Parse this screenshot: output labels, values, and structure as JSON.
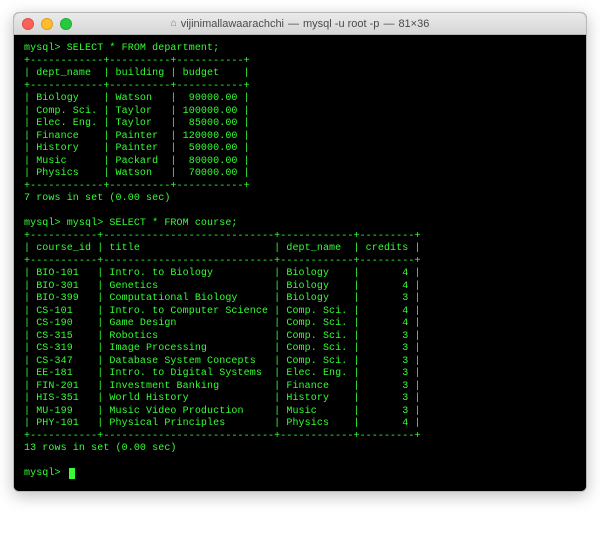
{
  "window": {
    "title_user": "vijinimallawaarachchi",
    "title_cmd": "mysql -u root -p",
    "title_dims": "81×36"
  },
  "prompt": "mysql>",
  "query1": {
    "sql": "SELECT * FROM department;",
    "headers": {
      "c1": "dept_name",
      "c2": "building",
      "c3": "budget"
    },
    "rows": [
      {
        "c1": "Biology",
        "c2": "Watson",
        "c3": "90000.00"
      },
      {
        "c1": "Comp. Sci.",
        "c2": "Taylor",
        "c3": "100000.00"
      },
      {
        "c1": "Elec. Eng.",
        "c2": "Taylor",
        "c3": "85000.00"
      },
      {
        "c1": "Finance",
        "c2": "Painter",
        "c3": "120000.00"
      },
      {
        "c1": "History",
        "c2": "Painter",
        "c3": "50000.00"
      },
      {
        "c1": "Music",
        "c2": "Packard",
        "c3": "80000.00"
      },
      {
        "c1": "Physics",
        "c2": "Watson",
        "c3": "70000.00"
      }
    ],
    "footer": "7 rows in set (0.00 sec)"
  },
  "query2": {
    "sql": "SELECT * FROM course;",
    "headers": {
      "c1": "course_id",
      "c2": "title",
      "c3": "dept_name",
      "c4": "credits"
    },
    "rows": [
      {
        "c1": "BIO-101",
        "c2": "Intro. to Biology",
        "c3": "Biology",
        "c4": "4"
      },
      {
        "c1": "BIO-301",
        "c2": "Genetics",
        "c3": "Biology",
        "c4": "4"
      },
      {
        "c1": "BIO-399",
        "c2": "Computational Biology",
        "c3": "Biology",
        "c4": "3"
      },
      {
        "c1": "CS-101",
        "c2": "Intro. to Computer Science",
        "c3": "Comp. Sci.",
        "c4": "4"
      },
      {
        "c1": "CS-190",
        "c2": "Game Design",
        "c3": "Comp. Sci.",
        "c4": "4"
      },
      {
        "c1": "CS-315",
        "c2": "Robotics",
        "c3": "Comp. Sci.",
        "c4": "3"
      },
      {
        "c1": "CS-319",
        "c2": "Image Processing",
        "c3": "Comp. Sci.",
        "c4": "3"
      },
      {
        "c1": "CS-347",
        "c2": "Database System Concepts",
        "c3": "Comp. Sci.",
        "c4": "3"
      },
      {
        "c1": "EE-181",
        "c2": "Intro. to Digital Systems",
        "c3": "Elec. Eng.",
        "c4": "3"
      },
      {
        "c1": "FIN-201",
        "c2": "Investment Banking",
        "c3": "Finance",
        "c4": "3"
      },
      {
        "c1": "HIS-351",
        "c2": "World History",
        "c3": "History",
        "c4": "3"
      },
      {
        "c1": "MU-199",
        "c2": "Music Video Production",
        "c3": "Music",
        "c4": "3"
      },
      {
        "c1": "PHY-101",
        "c2": "Physical Principles",
        "c3": "Physics",
        "c4": "4"
      }
    ],
    "footer": "13 rows in set (0.00 sec)"
  }
}
